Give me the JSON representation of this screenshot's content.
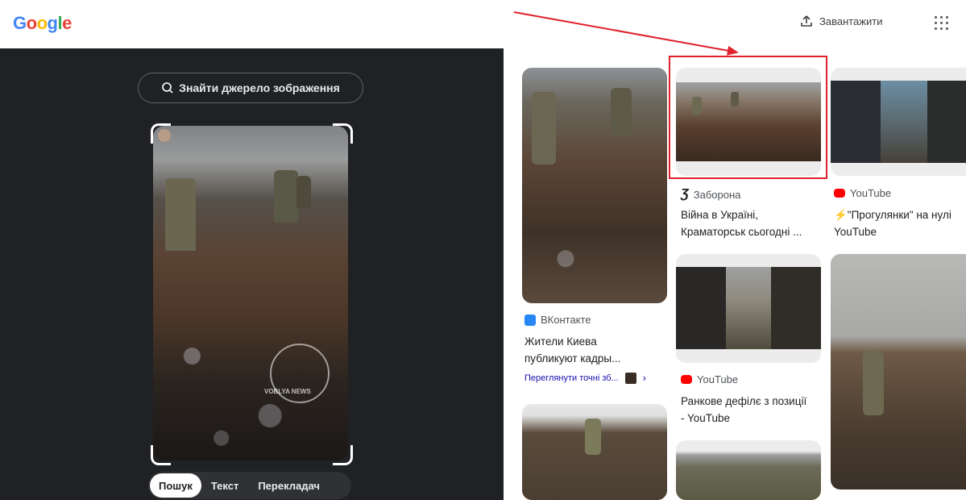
{
  "header": {
    "logo": "Google",
    "upload_label": "Завантажити"
  },
  "left": {
    "find_source": "Знайти джерело зображення",
    "watermark": "VOBLYA NEWS",
    "tabs": [
      "Пошук",
      "Текст",
      "Перекладач"
    ],
    "active_tab": "Пошук"
  },
  "results": [
    {
      "source": "ВКонтакте",
      "title_line1": "Жители Киева",
      "title_line2": "публикуют кадры..."
    },
    {
      "source": "Заборона",
      "title_line1": "Війна в Україні,",
      "title_line2": "Краматорськ сьогодні ..."
    },
    {
      "source": "YouTube",
      "title_line1": "⚡\"Прогулянки\" на нулі",
      "title_line2": "YouTube"
    },
    {
      "source": "YouTube",
      "title_line1": "Ранкове дефілє з позиції",
      "title_line2": "- YouTube"
    }
  ],
  "exact_matches_link": "Переглянути точні зб...",
  "colors": {
    "accent": "#1a0dab",
    "annotation": "#e0212a",
    "panel": "#202124"
  },
  "icons": [
    "upload-icon",
    "apps-icon",
    "lens-icon",
    "chevron-right-icon"
  ]
}
